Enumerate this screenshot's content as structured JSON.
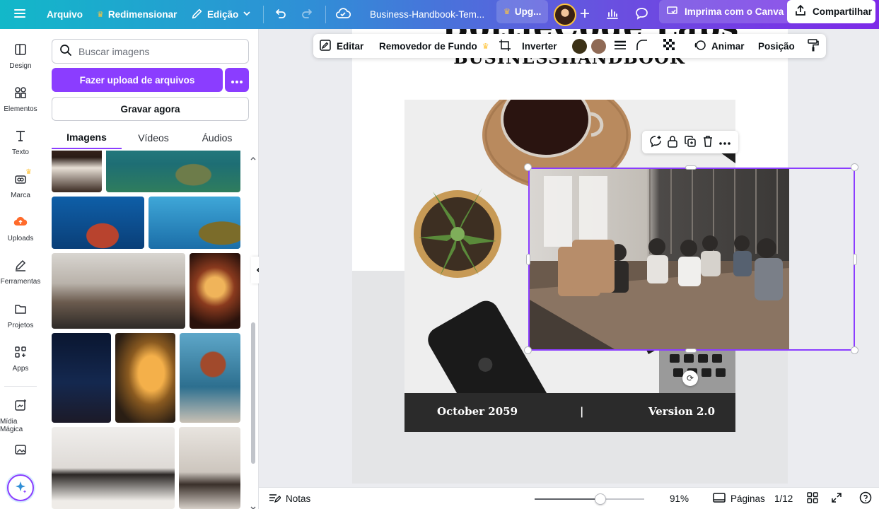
{
  "topbar": {
    "file_label": "Arquivo",
    "resize_label": "Redimensionar",
    "edit_label": "Edição",
    "doc_title": "Business-Handbook-Tem...",
    "upgrade_label": "Upg...",
    "print_label": "Imprima com o Canva",
    "share_label": "Compartilhar"
  },
  "rail": {
    "items": [
      {
        "label": "Design",
        "icon": "layout-icon"
      },
      {
        "label": "Elementos",
        "icon": "shapes-icon"
      },
      {
        "label": "Texto",
        "icon": "text-icon"
      },
      {
        "label": "Marca",
        "icon": "brand-icon"
      },
      {
        "label": "Uploads",
        "icon": "cloud-upload-icon"
      },
      {
        "label": "Ferramentas",
        "icon": "pen-icon"
      },
      {
        "label": "Projetos",
        "icon": "folder-icon"
      },
      {
        "label": "Apps",
        "icon": "apps-icon"
      },
      {
        "label": "Mídia Mágica",
        "icon": "magic-media-icon"
      }
    ]
  },
  "panel": {
    "search_placeholder": "Buscar imagens",
    "upload_label": "Fazer upload de arquivos",
    "record_label": "Gravar agora",
    "tabs": [
      "Imagens",
      "Vídeos",
      "Áudios"
    ],
    "active_tab": "Imagens"
  },
  "edit_toolbar": {
    "edit_label": "Editar",
    "bg_remover_label": "Removedor de Fundo",
    "flip_label": "Inverter",
    "animate_label": "Animar",
    "position_label": "Posição",
    "colors": [
      "#3b3116",
      "#8f6a55"
    ]
  },
  "document": {
    "title": "BottleCode Labs",
    "subtitle": "BUSINESSHANDBOOK",
    "banner_date": "October 2059",
    "banner_sep": "|",
    "banner_version": "Version 2.0"
  },
  "bottombar": {
    "notes_label": "Notas",
    "zoom": "91%",
    "zoom_value": 0.6,
    "pages_label": "Páginas",
    "page_count": "1/12"
  },
  "colors": {
    "accent": "#8b3dff",
    "banner": "#2b2b2b"
  }
}
